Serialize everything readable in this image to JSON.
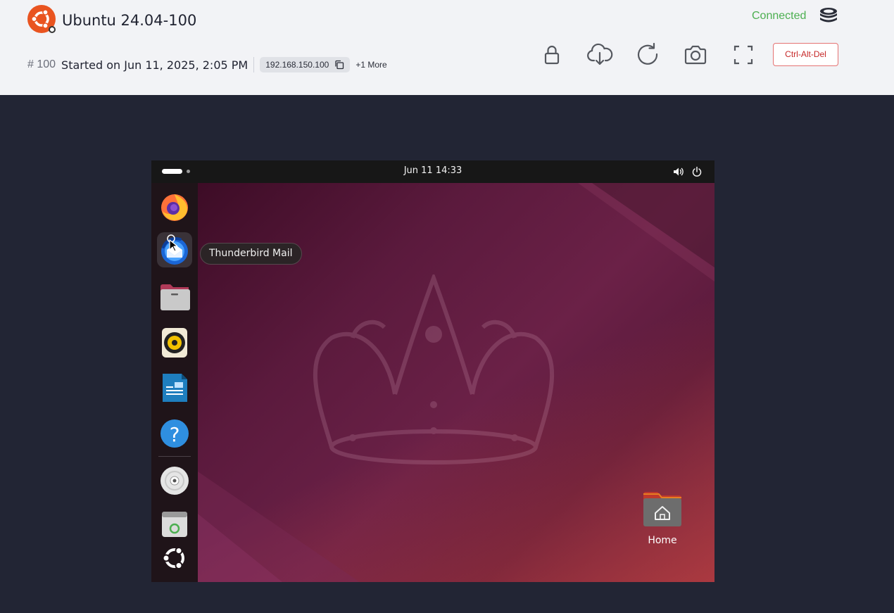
{
  "header": {
    "title": "Ubuntu 24.04-100",
    "connection_status": "Connected",
    "vm_id": "# 100",
    "started": "Started on Jun 11, 2025, 2:05 PM",
    "ip": "192.168.150.100",
    "more": "+1 More",
    "status_color": "#4caf50",
    "brand_color": "#e95420",
    "toolbar": {
      "lock_icon": "lock-icon",
      "download_icon": "cloud-download-icon",
      "refresh_icon": "refresh-icon",
      "screenshot_icon": "camera-icon",
      "fullscreen_icon": "fullscreen-icon",
      "ctrl_alt_del_label": "Ctrl-Alt-Del"
    }
  },
  "vm": {
    "clock": "Jun 11  14:33",
    "tooltip": "Thunderbird Mail",
    "dock_items": [
      "Firefox",
      "Thunderbird Mail",
      "Files",
      "Rhythmbox",
      "LibreOffice Writer",
      "Help",
      "Disc",
      "Trash",
      "Show Apps"
    ],
    "desktop_icons": [
      {
        "label": "Home"
      }
    ]
  }
}
